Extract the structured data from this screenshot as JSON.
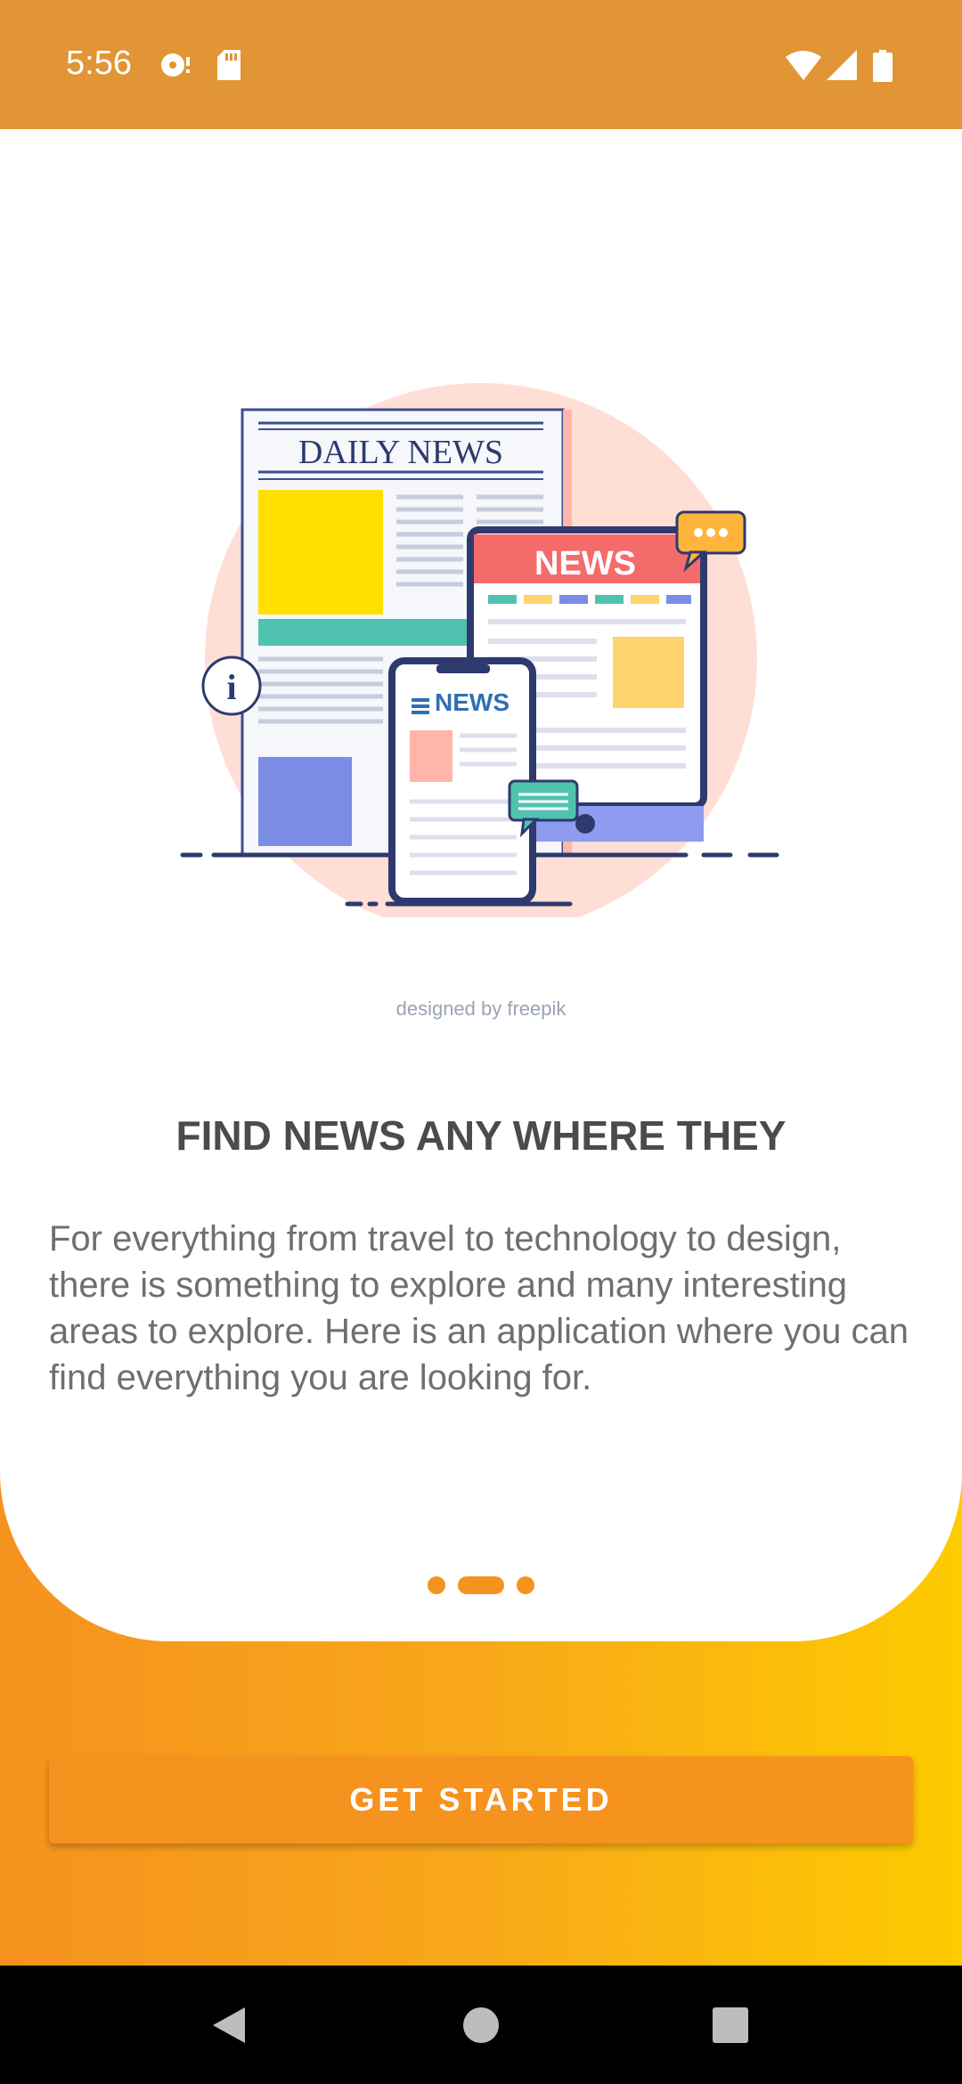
{
  "status_bar": {
    "time": "5:56",
    "icons": [
      "media-icon",
      "sd-card-icon",
      "wifi-icon",
      "signal-icon",
      "battery-icon"
    ]
  },
  "onboarding": {
    "illustration": {
      "newspaper_title": "DAILY NEWS",
      "tablet_title": "NEWS",
      "phone_title": "NEWS"
    },
    "credit": "designed by freepik",
    "headline": "FIND NEWS ANY WHERE THEY",
    "description": "For everything from travel to technology to design, there is something to explore and many interesting areas to explore. Here is an application where you can find everything you are looking for.",
    "page_indicator": {
      "current": 2,
      "total": 3
    }
  },
  "actions": {
    "get_started_label": "GET STARTED"
  },
  "navigation": {
    "icons": [
      "back-icon",
      "home-icon",
      "recents-icon"
    ]
  },
  "colors": {
    "status_bar": "#E29535",
    "accent": "#F6921E",
    "gradient_end": "#FDCB00"
  }
}
